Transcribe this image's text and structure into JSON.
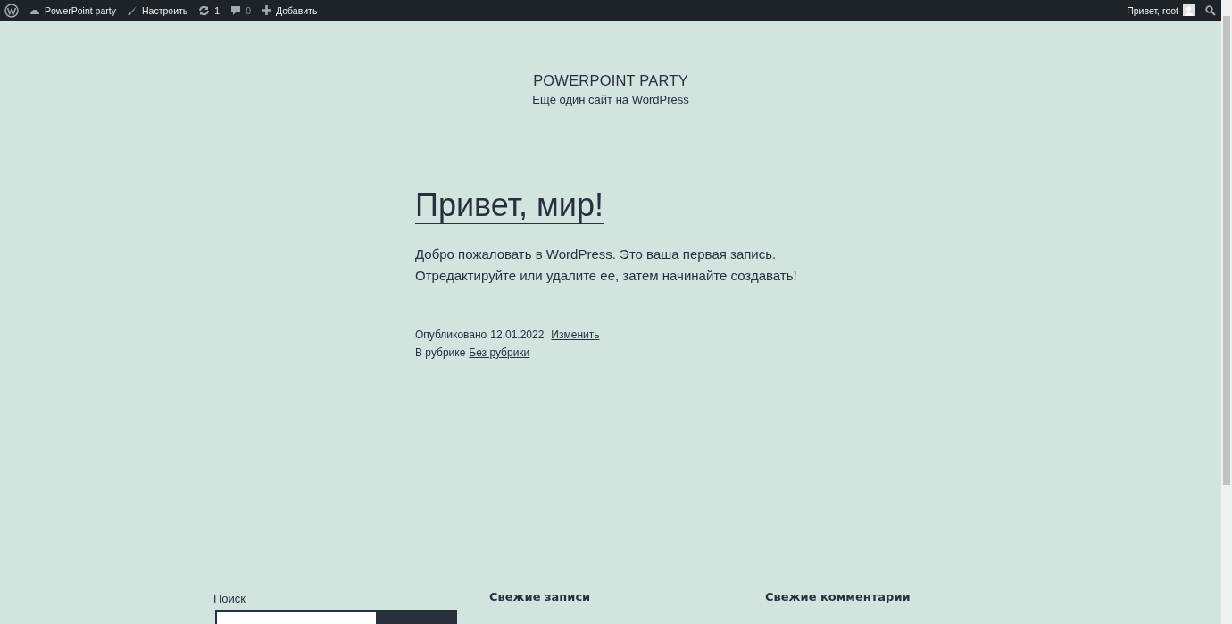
{
  "admin_bar": {
    "site_name": "PowerPoint party",
    "customize": "Настроить",
    "updates": "1",
    "comments": "0",
    "new": "Добавить",
    "greeting": "Привет, root"
  },
  "site": {
    "title": "POWERPOINT PARTY",
    "tagline": "Ещё один сайт на WordPress"
  },
  "post": {
    "title": "Привет, мир!",
    "body": [
      "Добро пожаловать в WordPress. Это ваша первая запись.",
      "Отредактируйте или удалите ее, затем начинайте создавать!"
    ],
    "published_label": "Опубликовано",
    "date": "12.01.2022",
    "edit_link": "Изменить",
    "category_label": "В рубрике",
    "category": "Без рубрики"
  },
  "footer": {
    "search_label": "Поиск",
    "recent_posts": "Свежие записи",
    "recent_comments": "Свежие комментарии"
  }
}
